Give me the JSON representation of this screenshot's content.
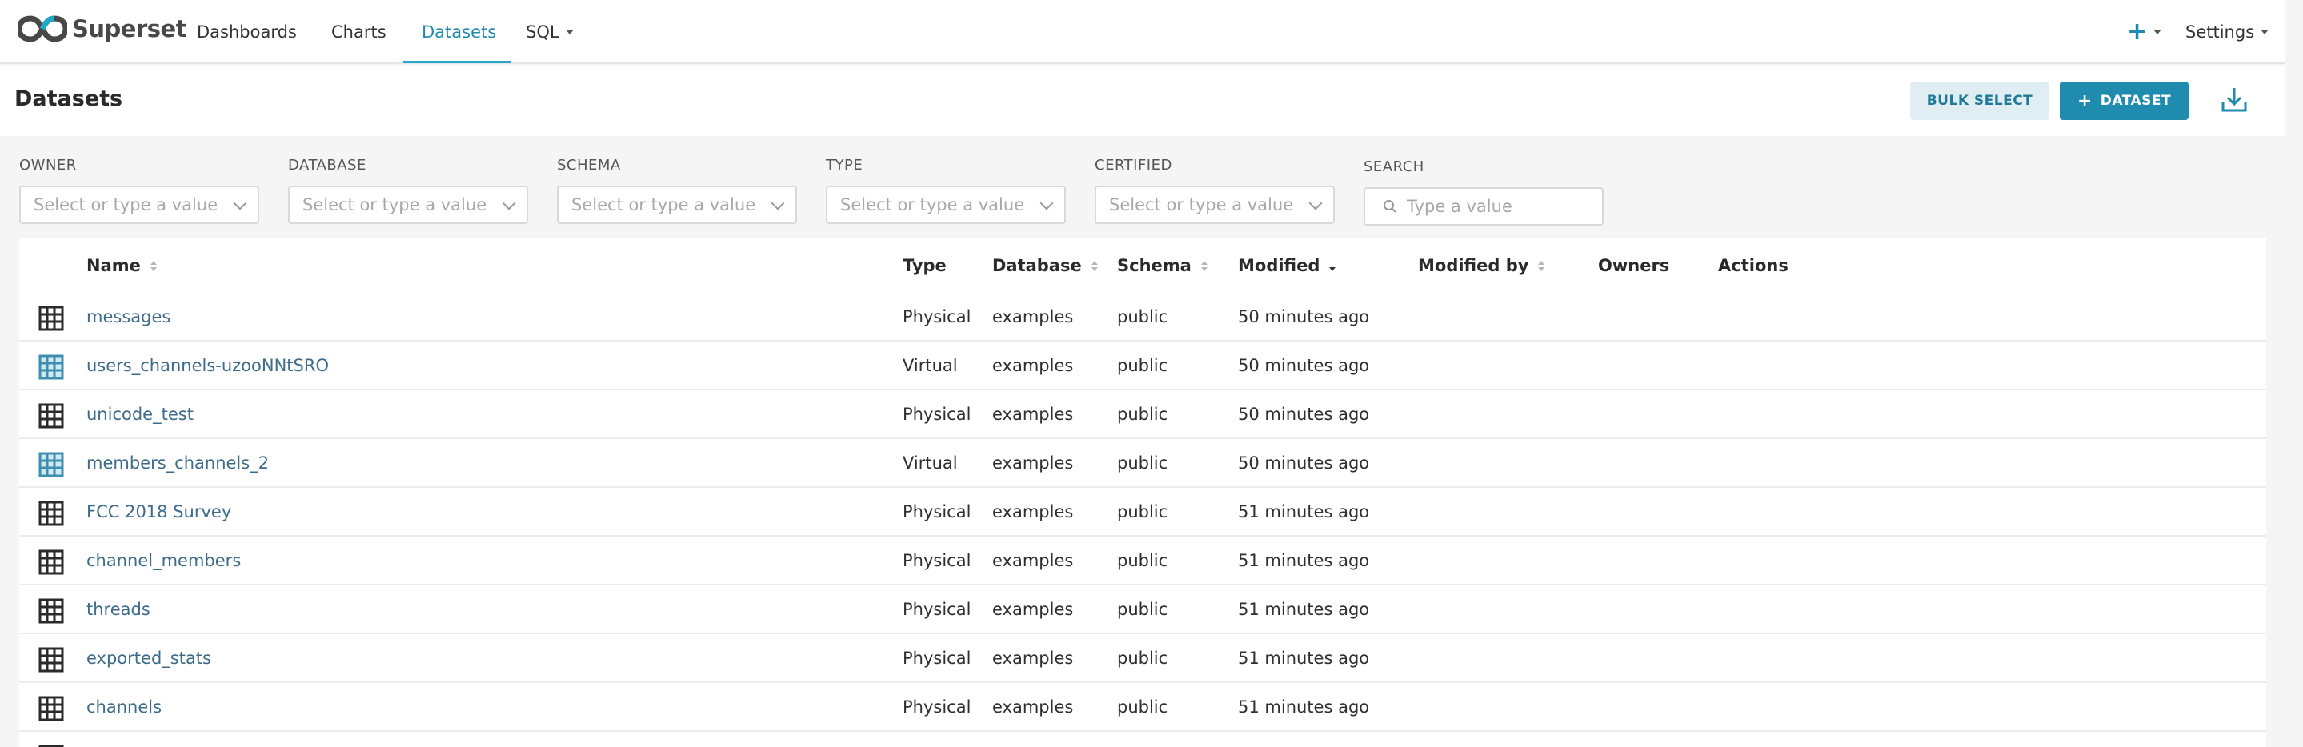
{
  "nav": {
    "brand": "Superset",
    "links": [
      "Dashboards",
      "Charts",
      "Datasets",
      "SQL"
    ],
    "plus": "+",
    "settings": "Settings"
  },
  "header": {
    "title": "Datasets",
    "bulk_select": "BULK SELECT",
    "add_dataset": "DATASET",
    "add_dataset_icon": "plus-icon",
    "download_icon": "download-icon"
  },
  "filters": [
    {
      "label": "OWNER",
      "placeholder": "Select or type a value"
    },
    {
      "label": "DATABASE",
      "placeholder": "Select or type a value"
    },
    {
      "label": "SCHEMA",
      "placeholder": "Select or type a value"
    },
    {
      "label": "TYPE",
      "placeholder": "Select or type a value"
    },
    {
      "label": "CERTIFIED",
      "placeholder": "Select or type a value"
    },
    {
      "label": "SEARCH",
      "placeholder": "Type a value"
    }
  ],
  "table": {
    "columns": [
      "Name",
      "Type",
      "Database",
      "Schema",
      "Modified",
      "Modified by",
      "Owners",
      "Actions"
    ],
    "rows": [
      {
        "icon": "physical-table-icon",
        "name": "messages",
        "type": "Physical",
        "database": "examples",
        "schema": "public",
        "modified": "50 minutes ago"
      },
      {
        "icon": "virtual-table-icon",
        "name": "users_channels-uzooNNtSRO",
        "type": "Virtual",
        "database": "examples",
        "schema": "public",
        "modified": "50 minutes ago"
      },
      {
        "icon": "physical-table-icon",
        "name": "unicode_test",
        "type": "Physical",
        "database": "examples",
        "schema": "public",
        "modified": "50 minutes ago"
      },
      {
        "icon": "virtual-table-icon",
        "name": "members_channels_2",
        "type": "Virtual",
        "database": "examples",
        "schema": "public",
        "modified": "50 minutes ago"
      },
      {
        "icon": "physical-table-icon",
        "name": "FCC 2018 Survey",
        "type": "Physical",
        "database": "examples",
        "schema": "public",
        "modified": "51 minutes ago"
      },
      {
        "icon": "physical-table-icon",
        "name": "channel_members",
        "type": "Physical",
        "database": "examples",
        "schema": "public",
        "modified": "51 minutes ago"
      },
      {
        "icon": "physical-table-icon",
        "name": "threads",
        "type": "Physical",
        "database": "examples",
        "schema": "public",
        "modified": "51 minutes ago"
      },
      {
        "icon": "physical-table-icon",
        "name": "exported_stats",
        "type": "Physical",
        "database": "examples",
        "schema": "public",
        "modified": "51 minutes ago"
      },
      {
        "icon": "physical-table-icon",
        "name": "channels",
        "type": "Physical",
        "database": "examples",
        "schema": "public",
        "modified": "51 minutes ago"
      }
    ]
  },
  "colors": {
    "accent": "#1f8bae",
    "link": "#3c6c8a",
    "bulk_bg": "#e0eef4",
    "virtual_icon": "#3d8fb0"
  }
}
